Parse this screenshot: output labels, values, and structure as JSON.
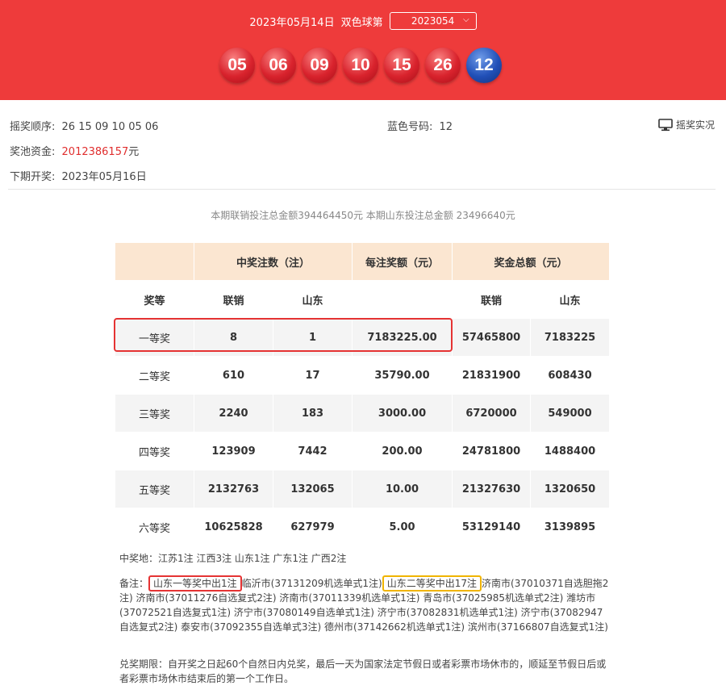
{
  "header": {
    "draw_date": "2023年05月14日",
    "lottery_name": "双色球第",
    "issue_select": {
      "selected": "2023054"
    },
    "red_balls": [
      "05",
      "06",
      "09",
      "10",
      "15",
      "26"
    ],
    "blue_ball": "12"
  },
  "info": {
    "order_label": "摇奖顺序:",
    "order_value": "26 15 09 10 05 06",
    "blue_label": "蓝色号码:",
    "blue_value": "12",
    "live_label": "摇奖实况",
    "pool_label": "奖池资金:",
    "pool_value": "2012386157",
    "pool_unit": "元",
    "next_label": "下期开奖:",
    "next_value": "2023年05月16日"
  },
  "sales_summary": "本期联销投注总金额394464450元 本期山东投注总金额 23496640元",
  "table": {
    "header_top": [
      "中奖注数（注）",
      "每注奖额（元）",
      "奖金总额（元）"
    ],
    "header_sub": [
      "奖等",
      "联销",
      "山东",
      "",
      "联销",
      "山东"
    ],
    "rows": [
      [
        "一等奖",
        "8",
        "1",
        "7183225.00",
        "57465800",
        "7183225"
      ],
      [
        "二等奖",
        "610",
        "17",
        "35790.00",
        "21831900",
        "608430"
      ],
      [
        "三等奖",
        "2240",
        "183",
        "3000.00",
        "6720000",
        "549000"
      ],
      [
        "四等奖",
        "123909",
        "7442",
        "200.00",
        "24781800",
        "1488400"
      ],
      [
        "五等奖",
        "2132763",
        "132065",
        "10.00",
        "21327630",
        "1320650"
      ],
      [
        "六等奖",
        "10625828",
        "627979",
        "5.00",
        "53129140",
        "3139895"
      ]
    ]
  },
  "notes": {
    "winning_places": "中奖地：江苏1注 江西3注 山东1注 广东1注 广西2注",
    "remark_label": "备注：",
    "remark_first": "山东一等奖中出1注",
    "remark_mid": "临沂市(37131209机选单式1注)",
    "remark_second": "山东二等奖中出17注",
    "remark_rest": "济南市(37010371自选胆拖2注) 济南市(37011276自选复式2注) 济南市(37011339机选单式1注) 青岛市(37025985机选单式2注) 潍坊市(37072521自选复式1注) 济宁市(37080149自选单式1注) 济宁市(37082831机选单式1注) 济宁市(37082947自选复式2注) 泰安市(37092355自选单式3注) 德州市(37142662机选单式1注) 滨州市(37166807自选复式1注)",
    "deadline": "兑奖期限：自开奖之日起60个自然日内兑奖，最后一天为国家法定节假日或者彩票市场休市的，顺延至节假日后或者彩票市场休市结束后的第一个工作日。"
  },
  "colors": {
    "header_bg": "#ee3b3b",
    "red_ball": "#d9232d",
    "blue_ball": "#2150b8",
    "table_head_bg": "#fbe6d1",
    "highlight_red": "#e53333",
    "highlight_yellow": "#f0b400"
  },
  "icons": {
    "live": "monitor-icon",
    "select": "chevron-down-icon"
  }
}
